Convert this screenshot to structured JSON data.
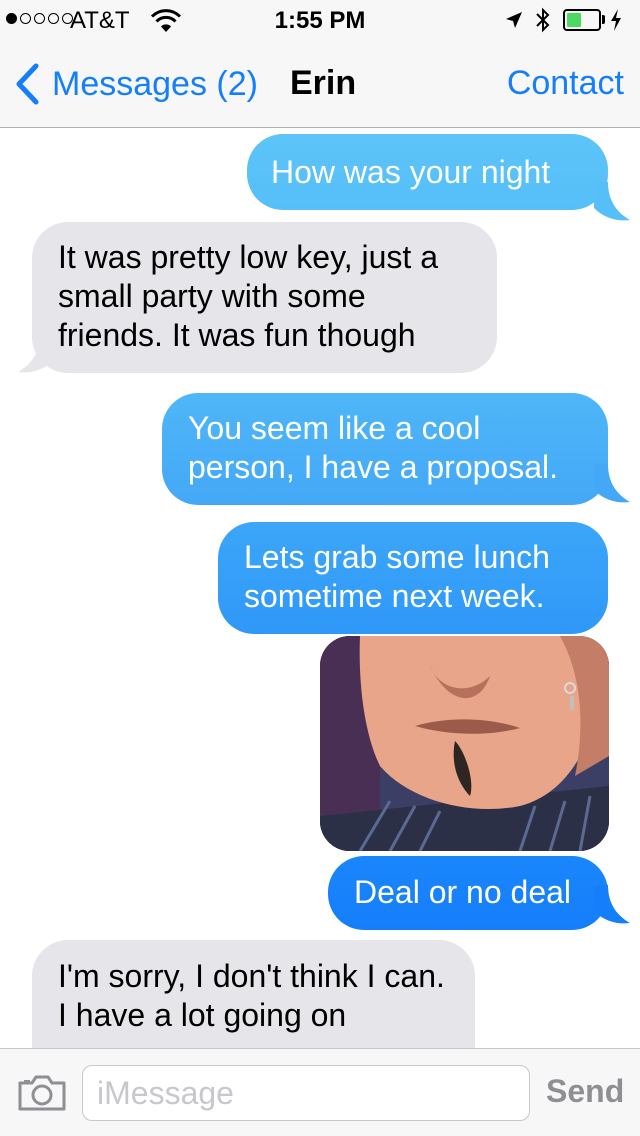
{
  "status_bar": {
    "carrier": "AT&T",
    "time": "1:55 PM",
    "signal_bars_filled": 1,
    "signal_bars_total": 5,
    "battery_fraction": 0.45,
    "battery_color": "#4cd964"
  },
  "nav": {
    "back_label": "Messages (2)",
    "title": "Erin",
    "contact_label": "Contact"
  },
  "messages": [
    {
      "direction": "outgoing",
      "text": "How was your night"
    },
    {
      "direction": "incoming",
      "text": "It was pretty low key, just a small party with some friends. It was fun though"
    },
    {
      "direction": "outgoing",
      "text": "You seem like a cool person, I have a proposal."
    },
    {
      "direction": "outgoing",
      "text": "Lets grab some lunch sometime next week."
    },
    {
      "direction": "outgoing",
      "type": "image",
      "image": "photo-of-man-with-goatee"
    },
    {
      "direction": "outgoing",
      "text": "Deal or no deal"
    },
    {
      "direction": "incoming",
      "text": "I'm sorry, I don't think I can. I have a lot going on"
    }
  ],
  "input_bar": {
    "placeholder": "iMessage",
    "send_label": "Send",
    "camera_icon": "camera-icon"
  },
  "colors": {
    "accent": "#157efb",
    "outgoing_top": "#5ac8fa",
    "outgoing_bottom": "#157efb",
    "incoming": "#e5e5ea"
  }
}
